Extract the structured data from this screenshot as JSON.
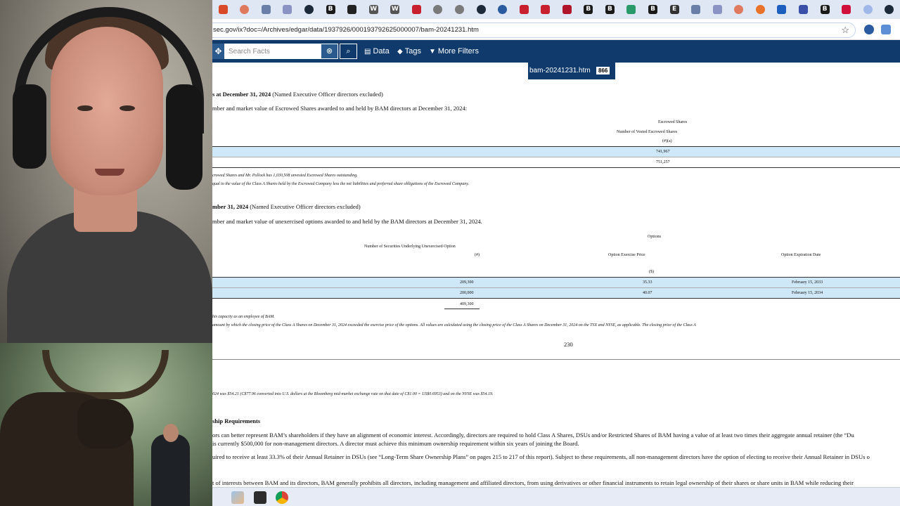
{
  "browser": {
    "bookmarks": [
      {
        "icon": "rd-icon",
        "glyph": "",
        "color": "#d84a2a"
      },
      {
        "icon": "circle-icon",
        "glyph": "",
        "color": "#e07a5f"
      },
      {
        "icon": "link-icon",
        "glyph": "",
        "color": "#6a7fa8"
      },
      {
        "icon": "dots-icon",
        "glyph": "",
        "color": "#8a93c4"
      },
      {
        "icon": "dark-circle-icon",
        "glyph": "",
        "color": "#1d2a3a"
      },
      {
        "icon": "b-icon",
        "glyph": "B",
        "color": "#1a1a1a"
      },
      {
        "icon": "square-icon",
        "glyph": "",
        "color": "#222"
      },
      {
        "icon": "w-icon",
        "glyph": "W",
        "color": "#555"
      },
      {
        "icon": "w-icon",
        "glyph": "W",
        "color": "#555"
      },
      {
        "icon": "maple-leaf-icon",
        "glyph": "",
        "color": "#c8202f"
      },
      {
        "icon": "clock-icon",
        "glyph": "",
        "color": "#7a7a7a"
      },
      {
        "icon": "clock-icon",
        "glyph": "",
        "color": "#7a7a7a"
      },
      {
        "icon": "dark-circle-icon",
        "glyph": "",
        "color": "#1d2a3a"
      },
      {
        "icon": "globe-icon",
        "glyph": "",
        "color": "#2a5aa0"
      },
      {
        "icon": "maple-leaf-icon",
        "glyph": "",
        "color": "#c8202f"
      },
      {
        "icon": "maple-leaf-icon",
        "glyph": "",
        "color": "#c8202f"
      },
      {
        "icon": "grid-icon",
        "glyph": "",
        "color": "#b0152a"
      },
      {
        "icon": "b-icon",
        "glyph": "B",
        "color": "#1a1a1a"
      },
      {
        "icon": "b-icon",
        "glyph": "B",
        "color": "#1a1a1a"
      },
      {
        "icon": "tree-icon",
        "glyph": "",
        "color": "#2a9a6a"
      },
      {
        "icon": "b-icon",
        "glyph": "B",
        "color": "#1a1a1a"
      },
      {
        "icon": "e-icon",
        "glyph": "E",
        "color": "#333"
      },
      {
        "icon": "link-icon",
        "glyph": "",
        "color": "#6a7fa8"
      },
      {
        "icon": "dots-icon",
        "glyph": "",
        "color": "#8a93c4"
      },
      {
        "icon": "circle-icon",
        "glyph": "",
        "color": "#e07a5f"
      },
      {
        "icon": "orange-circle-icon",
        "glyph": "",
        "color": "#e8722a"
      },
      {
        "icon": "blue-square-icon",
        "glyph": "",
        "color": "#1d5fbf"
      },
      {
        "icon": "wcs-icon",
        "glyph": "",
        "color": "#3a4fa8"
      },
      {
        "icon": "b-icon",
        "glyph": "B",
        "color": "#1a1a1a"
      },
      {
        "icon": "red-square-icon",
        "glyph": "",
        "color": "#d0103a"
      },
      {
        "icon": "circle-icon",
        "glyph": "",
        "color": "#9fb8e8"
      },
      {
        "icon": "dark-circle-icon",
        "glyph": "",
        "color": "#1d2a3a"
      }
    ],
    "url": "sec.gov/ix?doc=/Archives/edgar/data/1937926/000193792625000007/bam-20241231.htm"
  },
  "toolbar": {
    "search_placeholder": "Search Facts",
    "data_label": "Data",
    "tags_label": "Tags",
    "more_filters_label": "More Filters"
  },
  "filename": {
    "name": "bam-20241231.htm",
    "badge": "866"
  },
  "document": {
    "section1_title_bold": "s at December 31, 2024",
    "section1_title_rest": "(Named Executive Officer directors excluded)",
    "section1_intro": "mber and market value of Escrowed Shares awarded to and held by BAM directors at December 31, 2024:",
    "escrow_group_header": "Escrowed Shares",
    "escrow_col_header": "Number of Vested Escrowed Shares",
    "escrow_col_unit": "(#)(a)",
    "escrow_rows": [
      "741,967",
      "751,257"
    ],
    "escrow_fn1": "crowed Shares and Mr. Pollock has 1,030,508 unvested Escrowed Shares outstanding.",
    "escrow_fn2": "qual to the value of the Class A Shares held by the Escrowed Company less the net liabilities and preferred share obligations of the Escrowed Company.",
    "section2_title_bold": "mber 31, 2024",
    "section2_title_rest": "(Named Executive Officer directors excluded)",
    "section2_intro": "mber and market value of unexercised options awarded to and held by the BAM directors at December 31, 2024.",
    "options_group_header": "Options",
    "options_col1_header": "Number of Securities Underlying Unexercised Option",
    "options_col1_unit": "(#)",
    "options_col2_header": "Option Exercise Price",
    "options_col2_unit": "($)",
    "options_col3_header": "Option Expiration Date",
    "options_rows": [
      {
        "shares": "209,300",
        "price": "35.33",
        "expiry": "February 15, 2033"
      },
      {
        "shares": "200,000",
        "price": "40.07",
        "expiry": "February 15, 2034"
      }
    ],
    "options_total": "409,300",
    "options_fn1": "his capacity as an employee of BAM.",
    "options_fn2": "amount by which the closing price of the Class A Shares on December 31, 2024 exceeded the exercise price of the options. All values are calculated using the closing price of the Class A Shares on December 31, 2024 on the TSX and NYSE, as applicable. The closing price of the Class A",
    "page_number": "230",
    "price_note": "024 was $54.21 (C$77.96 converted into U.S. dollars at the Bloomberg mid-market exchange rate on that date of C$1.00 = US$0.6953) and on the NYSE was $54.19.",
    "ownership_heading": "ship Requirements",
    "ownership_p1_line1": "ors can better represent BAM’s shareholders if they have an alignment of economic interest. Accordingly, directors are required to hold Class A Shares, DSUs and/or Restricted Shares of BAM having a value of at least two times their aggregate annual retainer (the “Du",
    "ownership_p1_line2": "is currently $500,000 for non-management directors. A director must achieve this minimum ownership requirement within six years of joining the Board.",
    "ownership_p2": "uired to receive at least 33.3% of their Annual Retainer in DSUs (see “Long-Term Share Ownership Plans” on pages 215 to 217 of this report). Subject to these requirements, all non-management directors have the option of electing to receive their Annual Retainer in DSUs o",
    "cutoff_line": "t of interests between BAM and its directors, BAM generally prohibits all directors, including management and affiliated directors, from using derivatives or other financial instruments to retain legal ownership of their shares or share units in BAM while reducing their"
  }
}
